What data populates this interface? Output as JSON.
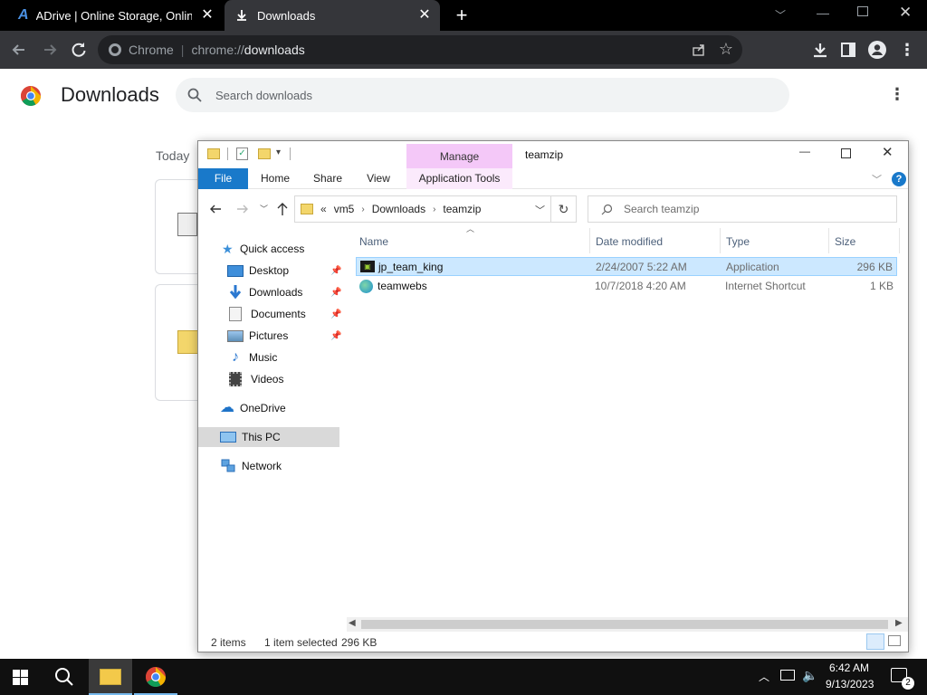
{
  "chrome": {
    "tabs": [
      {
        "title": "ADrive | Online Storage, Online B"
      },
      {
        "title": "Downloads"
      }
    ],
    "new_tab": "+",
    "url_scheme_label": "Chrome",
    "url_prefix": "chrome://",
    "url_path": "downloads"
  },
  "downloads_page": {
    "title": "Downloads",
    "search_placeholder": "Search downloads",
    "date_heading": "Today"
  },
  "explorer": {
    "quick_toolbar_arrow": "▾",
    "context_tab": "Manage",
    "title": "teamzip",
    "ribbon_tabs": [
      "File",
      "Home",
      "Share",
      "View",
      "Application Tools"
    ],
    "breadcrumb": {
      "overflow": "«",
      "parts": [
        "vm5",
        "Downloads",
        "teamzip"
      ]
    },
    "search_placeholder": "Search teamzip",
    "nav": {
      "quick_access": "Quick access",
      "items": [
        {
          "label": "Desktop",
          "icon": "desktop-icon",
          "pinned": true
        },
        {
          "label": "Downloads",
          "icon": "downloads-icon",
          "pinned": true
        },
        {
          "label": "Documents",
          "icon": "documents-icon",
          "pinned": true
        },
        {
          "label": "Pictures",
          "icon": "pictures-icon",
          "pinned": true
        },
        {
          "label": "Music",
          "icon": "music-icon",
          "pinned": false
        },
        {
          "label": "Videos",
          "icon": "videos-icon",
          "pinned": false
        }
      ],
      "onedrive": "OneDrive",
      "this_pc": "This PC",
      "network": "Network"
    },
    "columns": [
      "Name",
      "Date modified",
      "Type",
      "Size"
    ],
    "files": [
      {
        "name": "jp_team_king",
        "date": "2/24/2007 5:22 AM",
        "type": "Application",
        "size": "296 KB",
        "selected": true
      },
      {
        "name": "teamwebs",
        "date": "10/7/2018 4:20 AM",
        "type": "Internet Shortcut",
        "size": "1 KB",
        "selected": false
      }
    ],
    "status": {
      "count": "2 items",
      "selection": "1 item selected",
      "size": "296 KB"
    }
  },
  "taskbar": {
    "time": "6:42 AM",
    "date": "9/13/2023",
    "notification_count": "2"
  },
  "colors": {
    "selected_row": "#cce8ff",
    "file_tab": "#1979ca",
    "manage_tab": "#f4c8f8",
    "nav_selected": "#d9d9d9",
    "chrome_frame": "#35363a"
  }
}
